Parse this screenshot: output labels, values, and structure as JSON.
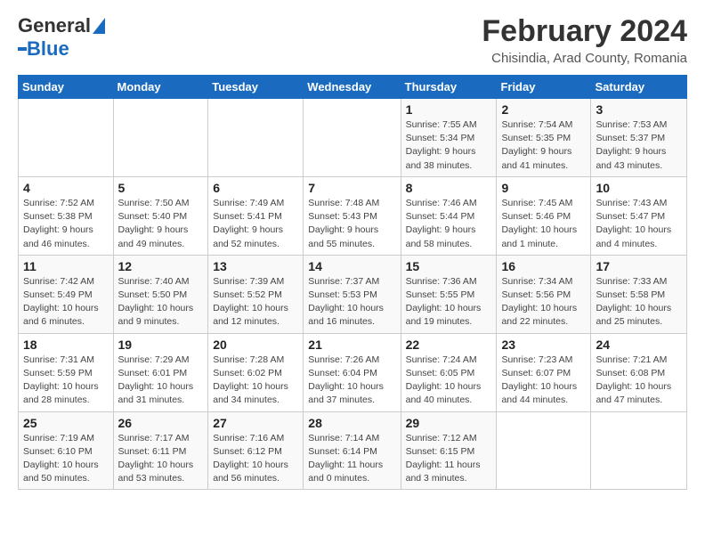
{
  "header": {
    "logo_line1": "General",
    "logo_line2": "Blue",
    "title": "February 2024",
    "subtitle": "Chisindia, Arad County, Romania"
  },
  "weekdays": [
    "Sunday",
    "Monday",
    "Tuesday",
    "Wednesday",
    "Thursday",
    "Friday",
    "Saturday"
  ],
  "weeks": [
    [
      {
        "day": "",
        "info": ""
      },
      {
        "day": "",
        "info": ""
      },
      {
        "day": "",
        "info": ""
      },
      {
        "day": "",
        "info": ""
      },
      {
        "day": "1",
        "info": "Sunrise: 7:55 AM\nSunset: 5:34 PM\nDaylight: 9 hours\nand 38 minutes."
      },
      {
        "day": "2",
        "info": "Sunrise: 7:54 AM\nSunset: 5:35 PM\nDaylight: 9 hours\nand 41 minutes."
      },
      {
        "day": "3",
        "info": "Sunrise: 7:53 AM\nSunset: 5:37 PM\nDaylight: 9 hours\nand 43 minutes."
      }
    ],
    [
      {
        "day": "4",
        "info": "Sunrise: 7:52 AM\nSunset: 5:38 PM\nDaylight: 9 hours\nand 46 minutes."
      },
      {
        "day": "5",
        "info": "Sunrise: 7:50 AM\nSunset: 5:40 PM\nDaylight: 9 hours\nand 49 minutes."
      },
      {
        "day": "6",
        "info": "Sunrise: 7:49 AM\nSunset: 5:41 PM\nDaylight: 9 hours\nand 52 minutes."
      },
      {
        "day": "7",
        "info": "Sunrise: 7:48 AM\nSunset: 5:43 PM\nDaylight: 9 hours\nand 55 minutes."
      },
      {
        "day": "8",
        "info": "Sunrise: 7:46 AM\nSunset: 5:44 PM\nDaylight: 9 hours\nand 58 minutes."
      },
      {
        "day": "9",
        "info": "Sunrise: 7:45 AM\nSunset: 5:46 PM\nDaylight: 10 hours\nand 1 minute."
      },
      {
        "day": "10",
        "info": "Sunrise: 7:43 AM\nSunset: 5:47 PM\nDaylight: 10 hours\nand 4 minutes."
      }
    ],
    [
      {
        "day": "11",
        "info": "Sunrise: 7:42 AM\nSunset: 5:49 PM\nDaylight: 10 hours\nand 6 minutes."
      },
      {
        "day": "12",
        "info": "Sunrise: 7:40 AM\nSunset: 5:50 PM\nDaylight: 10 hours\nand 9 minutes."
      },
      {
        "day": "13",
        "info": "Sunrise: 7:39 AM\nSunset: 5:52 PM\nDaylight: 10 hours\nand 12 minutes."
      },
      {
        "day": "14",
        "info": "Sunrise: 7:37 AM\nSunset: 5:53 PM\nDaylight: 10 hours\nand 16 minutes."
      },
      {
        "day": "15",
        "info": "Sunrise: 7:36 AM\nSunset: 5:55 PM\nDaylight: 10 hours\nand 19 minutes."
      },
      {
        "day": "16",
        "info": "Sunrise: 7:34 AM\nSunset: 5:56 PM\nDaylight: 10 hours\nand 22 minutes."
      },
      {
        "day": "17",
        "info": "Sunrise: 7:33 AM\nSunset: 5:58 PM\nDaylight: 10 hours\nand 25 minutes."
      }
    ],
    [
      {
        "day": "18",
        "info": "Sunrise: 7:31 AM\nSunset: 5:59 PM\nDaylight: 10 hours\nand 28 minutes."
      },
      {
        "day": "19",
        "info": "Sunrise: 7:29 AM\nSunset: 6:01 PM\nDaylight: 10 hours\nand 31 minutes."
      },
      {
        "day": "20",
        "info": "Sunrise: 7:28 AM\nSunset: 6:02 PM\nDaylight: 10 hours\nand 34 minutes."
      },
      {
        "day": "21",
        "info": "Sunrise: 7:26 AM\nSunset: 6:04 PM\nDaylight: 10 hours\nand 37 minutes."
      },
      {
        "day": "22",
        "info": "Sunrise: 7:24 AM\nSunset: 6:05 PM\nDaylight: 10 hours\nand 40 minutes."
      },
      {
        "day": "23",
        "info": "Sunrise: 7:23 AM\nSunset: 6:07 PM\nDaylight: 10 hours\nand 44 minutes."
      },
      {
        "day": "24",
        "info": "Sunrise: 7:21 AM\nSunset: 6:08 PM\nDaylight: 10 hours\nand 47 minutes."
      }
    ],
    [
      {
        "day": "25",
        "info": "Sunrise: 7:19 AM\nSunset: 6:10 PM\nDaylight: 10 hours\nand 50 minutes."
      },
      {
        "day": "26",
        "info": "Sunrise: 7:17 AM\nSunset: 6:11 PM\nDaylight: 10 hours\nand 53 minutes."
      },
      {
        "day": "27",
        "info": "Sunrise: 7:16 AM\nSunset: 6:12 PM\nDaylight: 10 hours\nand 56 minutes."
      },
      {
        "day": "28",
        "info": "Sunrise: 7:14 AM\nSunset: 6:14 PM\nDaylight: 11 hours\nand 0 minutes."
      },
      {
        "day": "29",
        "info": "Sunrise: 7:12 AM\nSunset: 6:15 PM\nDaylight: 11 hours\nand 3 minutes."
      },
      {
        "day": "",
        "info": ""
      },
      {
        "day": "",
        "info": ""
      }
    ]
  ]
}
